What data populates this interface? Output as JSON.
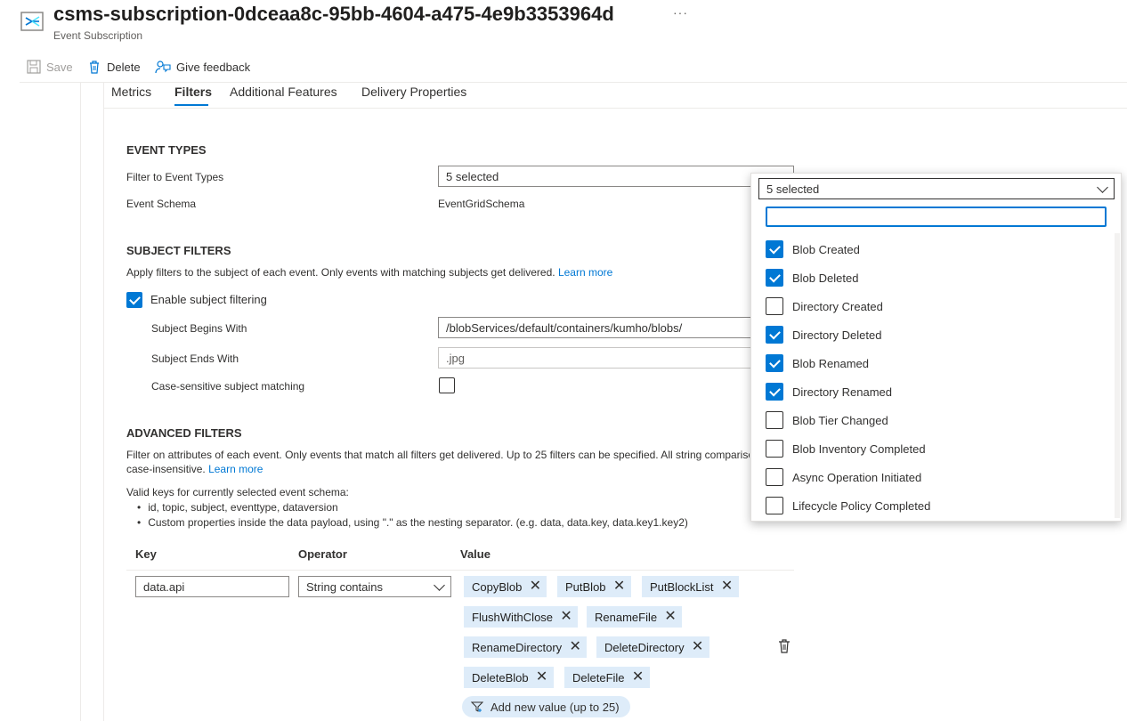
{
  "header": {
    "title": "csms-subscription-0dceaa8c-95bb-4604-a475-4e9b3353964d",
    "subtitle": "Event Subscription",
    "more": "···"
  },
  "toolbar": {
    "save": "Save",
    "delete": "Delete",
    "feedback": "Give feedback"
  },
  "tabs": [
    "Metrics",
    "Filters",
    "Additional Features",
    "Delivery Properties"
  ],
  "event_types": {
    "heading": "EVENT TYPES",
    "filter_label": "Filter to Event Types",
    "filter_value": "5 selected",
    "schema_label": "Event Schema",
    "schema_value": "EventGridSchema"
  },
  "subject_filters": {
    "heading": "SUBJECT FILTERS",
    "description": "Apply filters to the subject of each event. Only events with matching subjects get delivered.",
    "learn_more": "Learn more",
    "enable_label": "Enable subject filtering",
    "enable_checked": true,
    "begins_label": "Subject Begins With",
    "begins_value": "/blobServices/default/containers/kumho/blobs/",
    "ends_label": "Subject Ends With",
    "ends_value": ".jpg",
    "case_label": "Case-sensitive subject matching",
    "case_checked": false
  },
  "advanced_filters": {
    "heading": "ADVANCED FILTERS",
    "description_line1": "Filter on attributes of each event. Only events that match all filters get delivered. Up to 25 filters can be specified. All string comparisons are",
    "description_line2": "case-insensitive.",
    "learn_more": "Learn more",
    "valid_keys_title": "Valid keys for currently selected event schema:",
    "valid_keys": [
      "id, topic, subject, eventtype, dataversion",
      "Custom properties inside the data payload, using \".\" as the nesting separator. (e.g. data, data.key, data.key1.key2)"
    ],
    "columns": {
      "key": "Key",
      "operator": "Operator",
      "value": "Value"
    },
    "row": {
      "key": "data.api",
      "operator": "String contains",
      "values": [
        "CopyBlob",
        "PutBlob",
        "PutBlockList",
        "FlushWithClose",
        "RenameFile",
        "RenameDirectory",
        "DeleteDirectory",
        "DeleteBlob",
        "DeleteFile"
      ]
    },
    "add_value": "Add new value (up to 25)"
  },
  "dropdown": {
    "value": "5 selected",
    "search_placeholder": "",
    "options": [
      {
        "label": "Blob Created",
        "checked": true
      },
      {
        "label": "Blob Deleted",
        "checked": true
      },
      {
        "label": "Directory Created",
        "checked": false
      },
      {
        "label": "Directory Deleted",
        "checked": true
      },
      {
        "label": "Blob Renamed",
        "checked": true
      },
      {
        "label": "Directory Renamed",
        "checked": true
      },
      {
        "label": "Blob Tier Changed",
        "checked": false
      },
      {
        "label": "Blob Inventory Completed",
        "checked": false
      },
      {
        "label": "Async Operation Initiated",
        "checked": false
      },
      {
        "label": "Lifecycle Policy Completed",
        "checked": false
      }
    ]
  },
  "colors": {
    "accent": "#0078d4",
    "chip_bg": "#deecf9",
    "text": "#323130"
  }
}
